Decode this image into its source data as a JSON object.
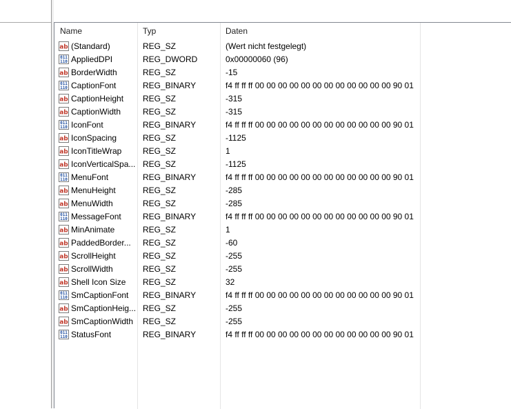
{
  "columns": {
    "name": "Name",
    "type": "Typ",
    "data": "Daten"
  },
  "rows": [
    {
      "name": "(Standard)",
      "type": "REG_SZ",
      "data": "(Wert nicht festgelegt)",
      "icon": "string-value-icon"
    },
    {
      "name": "AppliedDPI",
      "type": "REG_DWORD",
      "data": "0x00000060 (96)",
      "icon": "binary-value-icon"
    },
    {
      "name": "BorderWidth",
      "type": "REG_SZ",
      "data": "-15",
      "icon": "string-value-icon"
    },
    {
      "name": "CaptionFont",
      "type": "REG_BINARY",
      "data": "f4 ff ff ff 00 00 00 00 00 00 00 00 00 00 00 00 90 01 0...",
      "icon": "binary-value-icon"
    },
    {
      "name": "CaptionHeight",
      "type": "REG_SZ",
      "data": "-315",
      "icon": "string-value-icon"
    },
    {
      "name": "CaptionWidth",
      "type": "REG_SZ",
      "data": "-315",
      "icon": "string-value-icon"
    },
    {
      "name": "IconFont",
      "type": "REG_BINARY",
      "data": "f4 ff ff ff 00 00 00 00 00 00 00 00 00 00 00 00 90 01 0...",
      "icon": "binary-value-icon"
    },
    {
      "name": "IconSpacing",
      "type": "REG_SZ",
      "data": "-1125",
      "icon": "string-value-icon"
    },
    {
      "name": "IconTitleWrap",
      "type": "REG_SZ",
      "data": "1",
      "icon": "string-value-icon"
    },
    {
      "name": "IconVerticalSpa...",
      "type": "REG_SZ",
      "data": "-1125",
      "icon": "string-value-icon"
    },
    {
      "name": "MenuFont",
      "type": "REG_BINARY",
      "data": "f4 ff ff ff 00 00 00 00 00 00 00 00 00 00 00 00 90 01 0...",
      "icon": "binary-value-icon"
    },
    {
      "name": "MenuHeight",
      "type": "REG_SZ",
      "data": "-285",
      "icon": "string-value-icon"
    },
    {
      "name": "MenuWidth",
      "type": "REG_SZ",
      "data": "-285",
      "icon": "string-value-icon"
    },
    {
      "name": "MessageFont",
      "type": "REG_BINARY",
      "data": "f4 ff ff ff 00 00 00 00 00 00 00 00 00 00 00 00 90 01 0...",
      "icon": "binary-value-icon"
    },
    {
      "name": "MinAnimate",
      "type": "REG_SZ",
      "data": "1",
      "icon": "string-value-icon"
    },
    {
      "name": "PaddedBorder...",
      "type": "REG_SZ",
      "data": "-60",
      "icon": "string-value-icon"
    },
    {
      "name": "ScrollHeight",
      "type": "REG_SZ",
      "data": "-255",
      "icon": "string-value-icon"
    },
    {
      "name": "ScrollWidth",
      "type": "REG_SZ",
      "data": "-255",
      "icon": "string-value-icon"
    },
    {
      "name": "Shell Icon Size",
      "type": "REG_SZ",
      "data": "32",
      "icon": "string-value-icon"
    },
    {
      "name": "SmCaptionFont",
      "type": "REG_BINARY",
      "data": "f4 ff ff ff 00 00 00 00 00 00 00 00 00 00 00 00 90 01 0...",
      "icon": "binary-value-icon"
    },
    {
      "name": "SmCaptionHeig...",
      "type": "REG_SZ",
      "data": "-255",
      "icon": "string-value-icon"
    },
    {
      "name": "SmCaptionWidth",
      "type": "REG_SZ",
      "data": "-255",
      "icon": "string-value-icon"
    },
    {
      "name": "StatusFont",
      "type": "REG_BINARY",
      "data": "f4 ff ff ff 00 00 00 00 00 00 00 00 00 00 00 00 90 01 0...",
      "icon": "binary-value-icon"
    }
  ],
  "colors": {
    "string_icon_text": "#c0392b",
    "binary_icon_text": "#1f4fa0",
    "icon_border": "#7a7a7a"
  }
}
